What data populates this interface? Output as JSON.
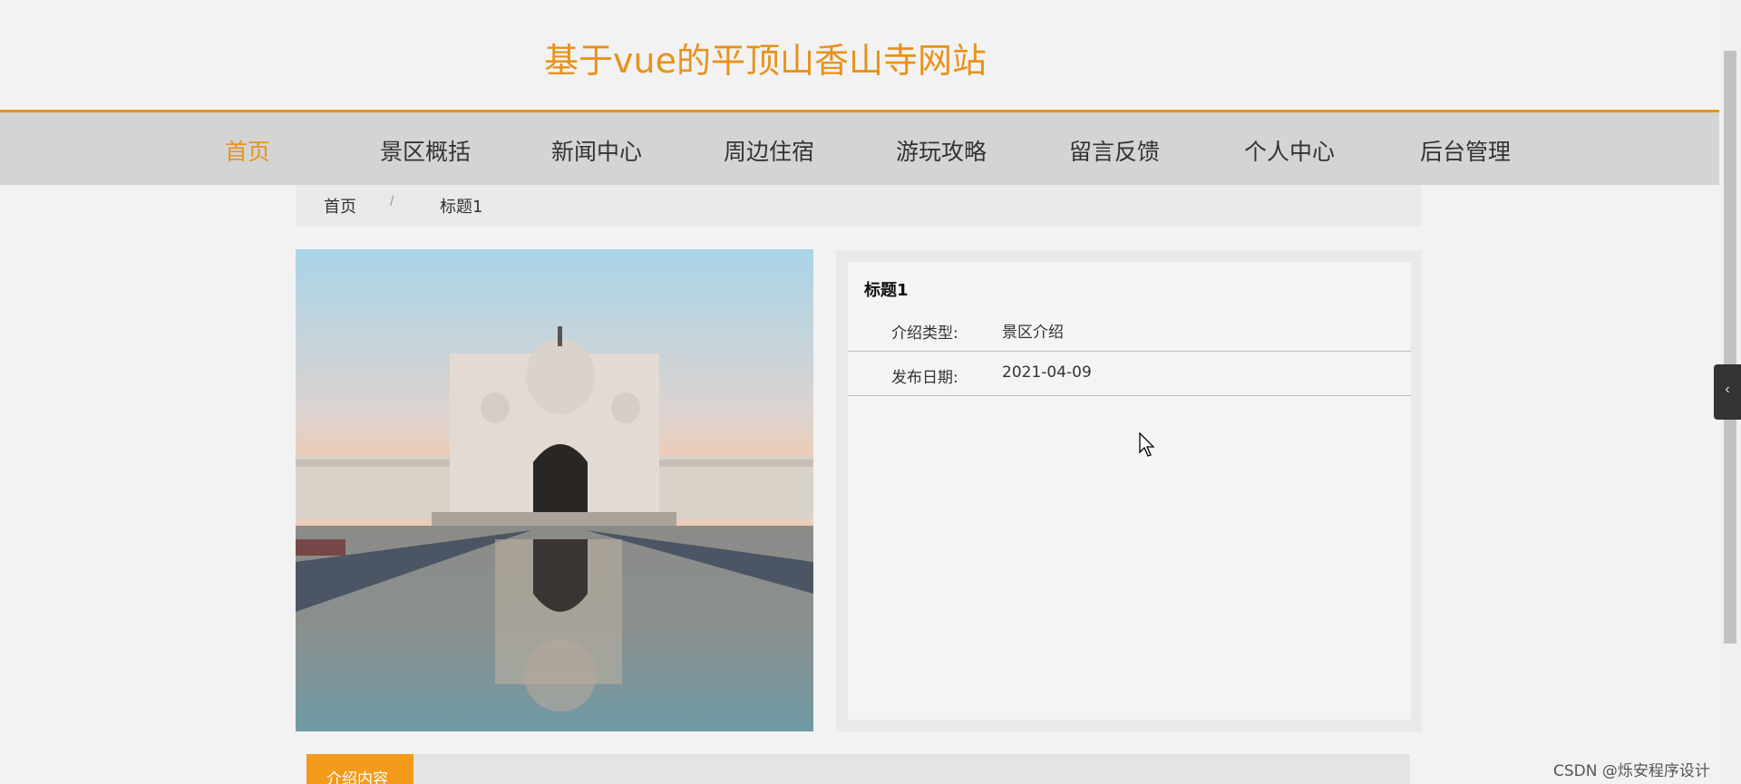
{
  "site": {
    "title": "基于vue的平顶山香山寺网站"
  },
  "nav": {
    "items": [
      {
        "label": "首页",
        "active": true
      },
      {
        "label": "景区概括",
        "active": false
      },
      {
        "label": "新闻中心",
        "active": false
      },
      {
        "label": "周边住宿",
        "active": false
      },
      {
        "label": "游玩攻略",
        "active": false
      },
      {
        "label": "留言反馈",
        "active": false
      },
      {
        "label": "个人中心",
        "active": false
      },
      {
        "label": "后台管理",
        "active": false
      }
    ]
  },
  "breadcrumb": {
    "home": "首页",
    "separator": "/",
    "current": "标题1"
  },
  "detail": {
    "title": "标题1",
    "fields": [
      {
        "label": "介绍类型:",
        "value": "景区介绍"
      },
      {
        "label": "发布日期:",
        "value": "2021-04-09"
      }
    ]
  },
  "content_tab": {
    "label": "介绍内容"
  },
  "side_toggle": {
    "icon": "chevron-left-icon"
  },
  "watermark": "CSDN @烁安程序设计",
  "colors": {
    "accent": "#e8921b",
    "tab": "#f29a1a",
    "nav_bg": "#d4d4d4"
  }
}
